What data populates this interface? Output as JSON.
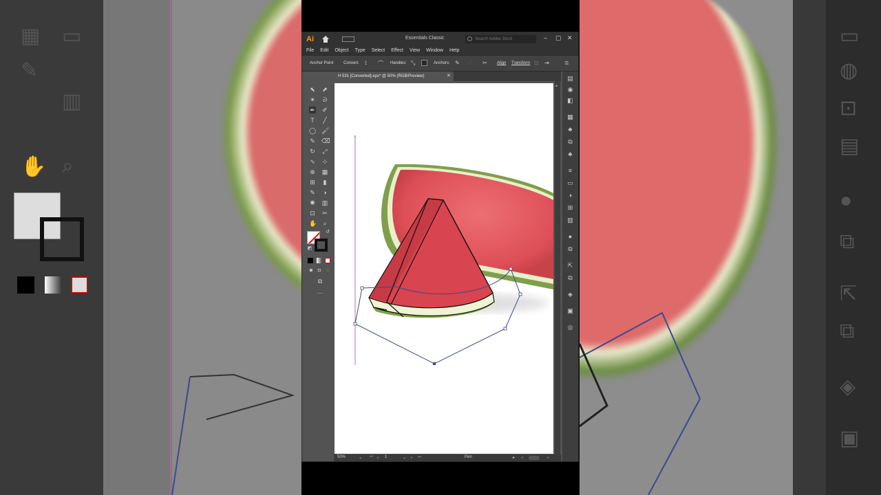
{
  "app": {
    "logo": "Ai",
    "workspace": "Essentials Classic",
    "search_placeholder": "Search Adobe Stock",
    "window_controls": [
      "–",
      "▢",
      "✕"
    ]
  },
  "menu": [
    "File",
    "Edit",
    "Object",
    "Type",
    "Select",
    "Effect",
    "View",
    "Window",
    "Help"
  ],
  "control_bar": {
    "mode": "Anchor Point",
    "convert": "Convert:",
    "handles": "Handles:",
    "anchors": "Anchors:",
    "align": "Align",
    "transform": "Transform"
  },
  "document_tab": {
    "title": "H 531 [Converted].eps* @ 50% (RGB/Preview)",
    "close": "✕"
  },
  "status": {
    "zoom": "50%",
    "artboard": "1",
    "tool": "Pen"
  },
  "colors": {
    "accent": "#ff9a00",
    "panel": "#535353",
    "dark": "#323232",
    "path": "#3b4a8c"
  }
}
